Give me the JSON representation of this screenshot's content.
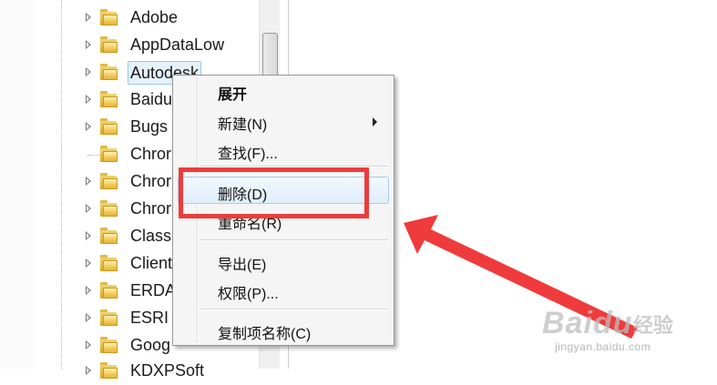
{
  "tree": {
    "items": [
      {
        "label": "Adobe"
      },
      {
        "label": "AppDataLow"
      },
      {
        "label": "Autodesk"
      },
      {
        "label": "Baidu"
      },
      {
        "label": "Bugs"
      },
      {
        "label": "Chror"
      },
      {
        "label": "Chror"
      },
      {
        "label": "Chror"
      },
      {
        "label": "Class"
      },
      {
        "label": "Client"
      },
      {
        "label": "ERDA"
      },
      {
        "label": "ESRI"
      },
      {
        "label": "Goog"
      },
      {
        "label": "KDXPSoft"
      }
    ]
  },
  "context_menu": {
    "expand": "展开",
    "new": "新建(N)",
    "find": "查找(F)...",
    "delete": "删除(D)",
    "rename": "重命名(R)",
    "export": "导出(E)",
    "permissions": "权限(P)...",
    "copy_key_name": "复制项名称(C)"
  },
  "annotation": {
    "highlight_color": "#ef3b3b"
  },
  "watermark": {
    "brand": "Baidu",
    "brand_cn": "经验",
    "url": "jingyan.baidu.com"
  }
}
